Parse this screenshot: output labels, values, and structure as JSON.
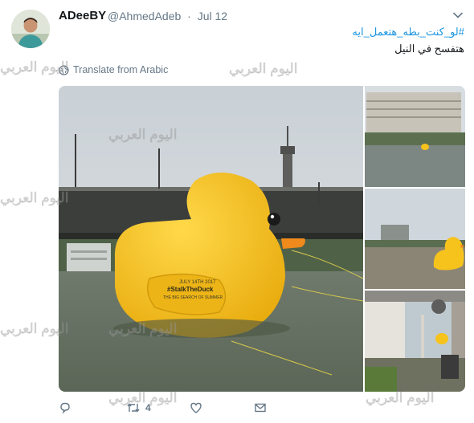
{
  "tweet": {
    "display_name": "ADeeBY",
    "handle": "@AhmedAdeb",
    "separator": "·",
    "date": "Jul 12",
    "hashtag": "#لو_كنت_بطه_هتعمل_ايه",
    "text_rtl": "هتفسح في النيل",
    "translate_label": "Translate from Arabic"
  },
  "actions": {
    "retweet_count": "4"
  },
  "watermark": {
    "text": "اليوم العربي"
  },
  "photo": {
    "duck_text_1": "JULY 14TH 2017",
    "duck_text_2": "#StalkTheDuck",
    "duck_text_3": "THE BIG SEARCH OF SUMMER"
  },
  "colors": {
    "link": "#1b95e0",
    "muted": "#657786",
    "duck": "#f6c21c"
  }
}
